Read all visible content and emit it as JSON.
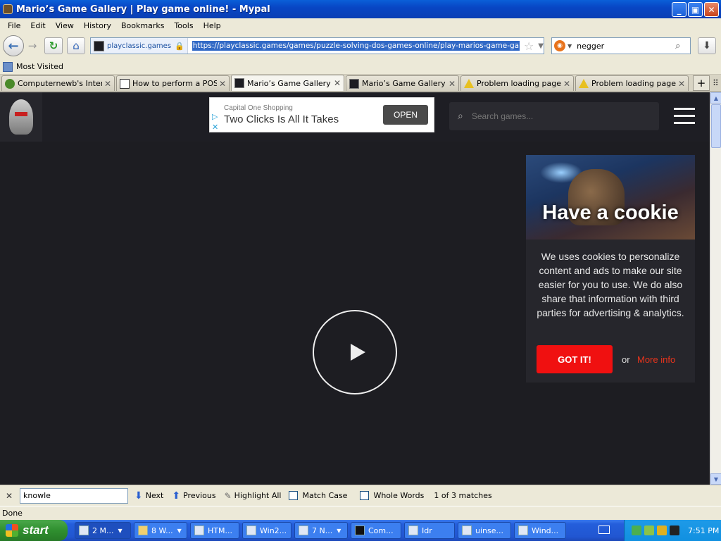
{
  "window": {
    "title": "Mario’s Game Gallery | Play game online! - Mypal"
  },
  "menu": [
    "File",
    "Edit",
    "View",
    "History",
    "Bookmarks",
    "Tools",
    "Help"
  ],
  "nav": {
    "site_label": "playclassic.games",
    "url": "https://playclassic.games/games/puzzle-solving-dos-games-online/play-marios-game-gallery-online/",
    "search_value": "negger"
  },
  "bookmarks": {
    "most_visited": "Most Visited"
  },
  "tabs": [
    {
      "label": "Computernewb's Inter..."
    },
    {
      "label": "How to perform a POS..."
    },
    {
      "label": "Mario’s Game Gallery | ..."
    },
    {
      "label": "Mario’s Game Gallery | ..."
    },
    {
      "label": "Problem loading page"
    },
    {
      "label": "Problem loading page"
    }
  ],
  "page": {
    "ad": {
      "sponsor": "Capital One Shopping",
      "headline": "Two Clicks Is All It Takes",
      "cta": "OPEN"
    },
    "search_placeholder": "Search games...",
    "cookie": {
      "title": "Have a cookie",
      "text": "We uses cookies to personalize content and ads to make our site easier for you to use. We do also share that information with third parties for advertising & analytics.",
      "accept": "GOT IT!",
      "or": "or",
      "more": "More info"
    }
  },
  "findbar": {
    "query": "knowle",
    "next": "Next",
    "previous": "Previous",
    "highlight_all": "Highlight All",
    "match_case": "Match Case",
    "whole_words": "Whole Words",
    "status": "1 of 3 matches"
  },
  "status": "Done",
  "taskbar": {
    "start": "start",
    "buttons": [
      "2 M...",
      "8 W...",
      "HTM...",
      "Win2...",
      "7 N...",
      "Com...",
      "Idr",
      "uinse...",
      "Wind..."
    ],
    "clock": "7:51 PM"
  }
}
